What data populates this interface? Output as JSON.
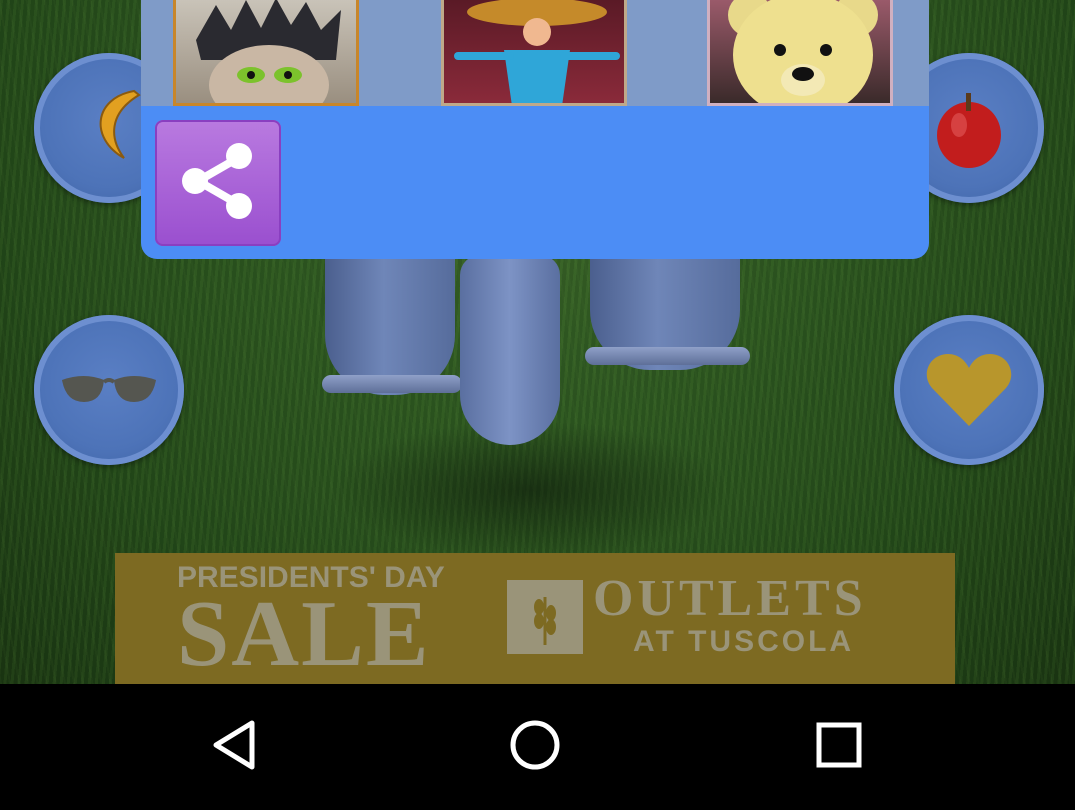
{
  "game": {
    "left_buttons": [
      {
        "icon": "banana-icon"
      },
      {
        "icon": "sunglasses-icon"
      }
    ],
    "right_buttons": [
      {
        "icon": "apple-icon"
      },
      {
        "icon": "heart-icon"
      }
    ]
  },
  "popup": {
    "thumbnails": [
      {
        "icon": "hedgehog-character-thumbnail"
      },
      {
        "icon": "doll-character-thumbnail"
      },
      {
        "icon": "teddy-bear-thumbnail"
      }
    ],
    "share_icon": "share-icon"
  },
  "ad": {
    "line1": "PRESIDENTS' DAY",
    "line2": "SALE",
    "brand": "OUTLETS",
    "brand_sub": "AT TUSCOLA"
  },
  "navbar": {
    "back_icon": "back-triangle-icon",
    "home_icon": "home-circle-icon",
    "recents_icon": "recents-square-icon"
  },
  "colors": {
    "popup_blue": "#4c8df5",
    "share_purple": "#a55ed6",
    "ad_gold": "#7d6a22"
  }
}
